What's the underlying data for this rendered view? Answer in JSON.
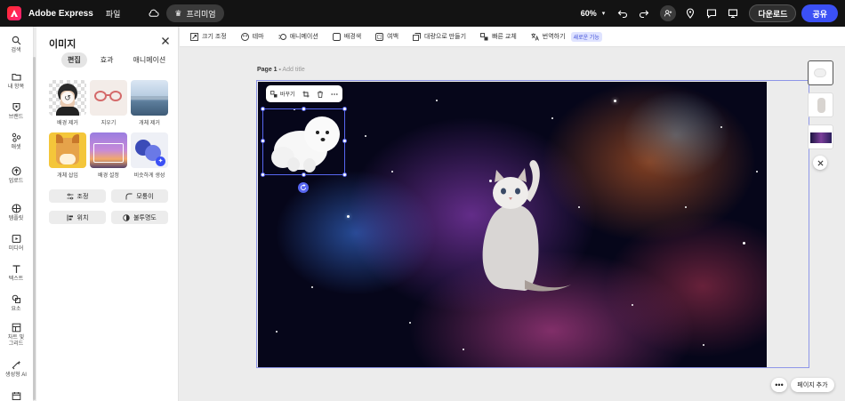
{
  "app": {
    "brand": "Adobe Express",
    "file_menu": "파일",
    "premium": "프리미엄",
    "zoom": "60%",
    "download": "다운로드",
    "share": "공유"
  },
  "rail": {
    "items": [
      {
        "label": "검색",
        "icon": "search-icon"
      },
      {
        "label": "내 항목",
        "icon": "folder-icon"
      },
      {
        "label": "브랜드",
        "icon": "brand-icon"
      },
      {
        "label": "애셋",
        "icon": "assets-icon"
      },
      {
        "label": "업로드",
        "icon": "upload-icon"
      },
      {
        "label": "템플릿",
        "icon": "template-icon"
      },
      {
        "label": "미디어",
        "icon": "media-icon"
      },
      {
        "label": "텍스트",
        "icon": "text-icon"
      },
      {
        "label": "요소",
        "icon": "elements-icon"
      },
      {
        "label": "차트 및\n그리드",
        "icon": "grid-icon"
      },
      {
        "label": "생성형 AI",
        "icon": "ai-icon"
      },
      {
        "label": "",
        "icon": "calendar-icon"
      }
    ]
  },
  "panel": {
    "title": "이미지",
    "tabs": [
      "편집",
      "효과",
      "애니메이션"
    ],
    "tools": [
      {
        "label": "배경 제거"
      },
      {
        "label": "지우기"
      },
      {
        "label": "개체 제거"
      },
      {
        "label": "개체 삽입"
      },
      {
        "label": "배경 설정"
      },
      {
        "label": "비슷하게 생성"
      }
    ],
    "buttons": [
      "조정",
      "모퉁이",
      "위치",
      "불투명도"
    ]
  },
  "ctxbar": {
    "items": [
      "크기 조정",
      "테마",
      "애니메이션",
      "배경색",
      "여백",
      "대량으로 만들기",
      "빠른 교체",
      "번역하기"
    ],
    "new_badge": "새로운 기능"
  },
  "canvas": {
    "page_label": "Page 1 -",
    "add_title": "Add title",
    "replace": "바꾸기"
  },
  "footer": {
    "more": "•••",
    "add_page": "페이지 추가"
  },
  "colors": {
    "accent": "#3b50f5",
    "selection": "#5766f0",
    "topbar": "#131313"
  }
}
